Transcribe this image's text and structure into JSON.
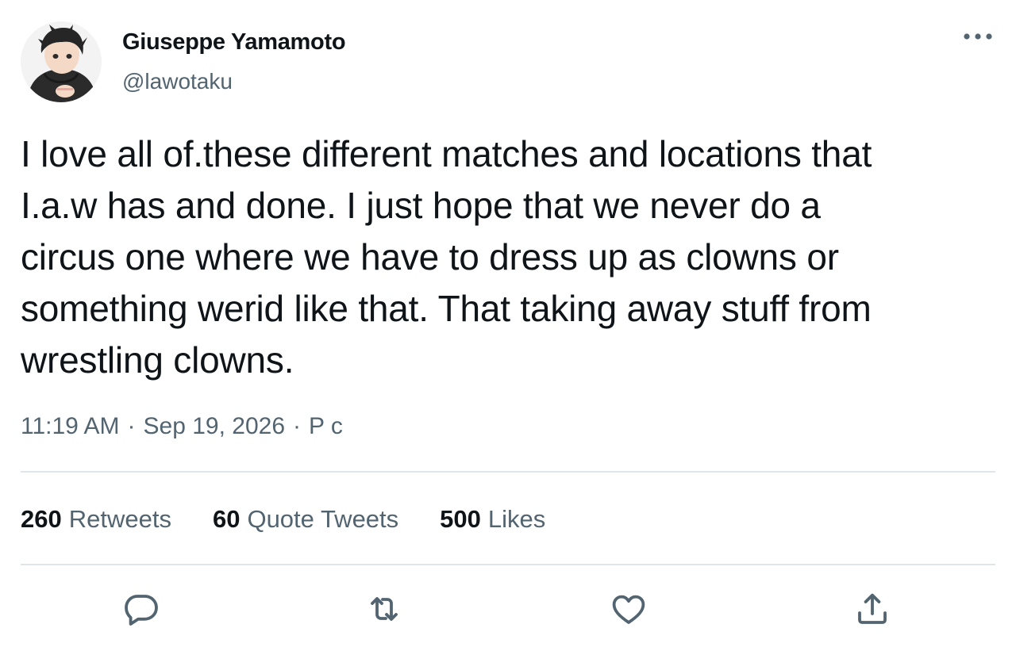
{
  "author": {
    "display_name": "Giuseppe Yamamoto",
    "handle": "@lawotaku"
  },
  "tweet": {
    "text": "I love all of.these different matches and locations that\nI.a.w has and done. I just hope that we never do a\ncircus one where we have to dress up as clowns or\nsomething werid like that. That taking away stuff from\nwrestling clowns."
  },
  "meta": {
    "time": "11:19 AM",
    "separator": "·",
    "date": "Sep 19, 2026",
    "source": "P c"
  },
  "stats": [
    {
      "count": "260",
      "label": "Retweets"
    },
    {
      "count": "60",
      "label": "Quote Tweets"
    },
    {
      "count": "500",
      "label": "Likes"
    }
  ],
  "actions": [
    {
      "icon": "reply-icon"
    },
    {
      "icon": "retweet-icon"
    },
    {
      "icon": "like-icon"
    },
    {
      "icon": "share-icon"
    }
  ],
  "colors": {
    "text_primary": "#0f1419",
    "text_secondary": "#536471",
    "divider": "#dfe5e9"
  }
}
